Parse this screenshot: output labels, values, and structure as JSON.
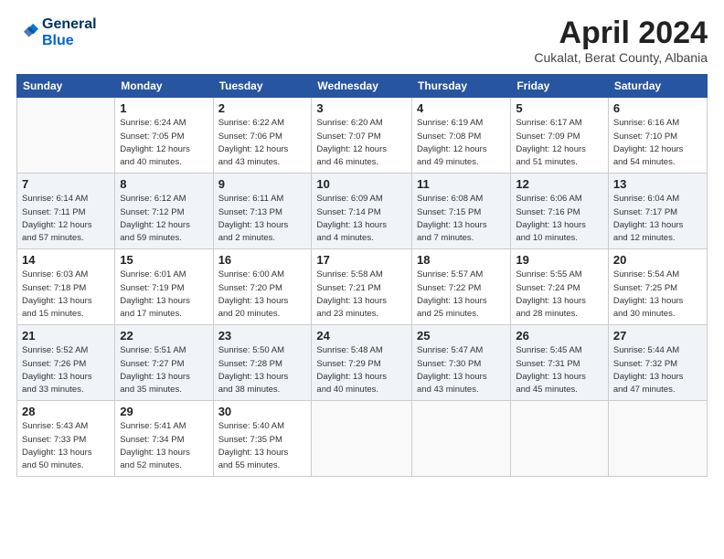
{
  "header": {
    "logo_line1": "General",
    "logo_line2": "Blue",
    "month": "April 2024",
    "location": "Cukalat, Berat County, Albania"
  },
  "days_of_week": [
    "Sunday",
    "Monday",
    "Tuesday",
    "Wednesday",
    "Thursday",
    "Friday",
    "Saturday"
  ],
  "weeks": [
    [
      {
        "day": "",
        "info": ""
      },
      {
        "day": "1",
        "info": "Sunrise: 6:24 AM\nSunset: 7:05 PM\nDaylight: 12 hours\nand 40 minutes."
      },
      {
        "day": "2",
        "info": "Sunrise: 6:22 AM\nSunset: 7:06 PM\nDaylight: 12 hours\nand 43 minutes."
      },
      {
        "day": "3",
        "info": "Sunrise: 6:20 AM\nSunset: 7:07 PM\nDaylight: 12 hours\nand 46 minutes."
      },
      {
        "day": "4",
        "info": "Sunrise: 6:19 AM\nSunset: 7:08 PM\nDaylight: 12 hours\nand 49 minutes."
      },
      {
        "day": "5",
        "info": "Sunrise: 6:17 AM\nSunset: 7:09 PM\nDaylight: 12 hours\nand 51 minutes."
      },
      {
        "day": "6",
        "info": "Sunrise: 6:16 AM\nSunset: 7:10 PM\nDaylight: 12 hours\nand 54 minutes."
      }
    ],
    [
      {
        "day": "7",
        "info": "Sunrise: 6:14 AM\nSunset: 7:11 PM\nDaylight: 12 hours\nand 57 minutes."
      },
      {
        "day": "8",
        "info": "Sunrise: 6:12 AM\nSunset: 7:12 PM\nDaylight: 12 hours\nand 59 minutes."
      },
      {
        "day": "9",
        "info": "Sunrise: 6:11 AM\nSunset: 7:13 PM\nDaylight: 13 hours\nand 2 minutes."
      },
      {
        "day": "10",
        "info": "Sunrise: 6:09 AM\nSunset: 7:14 PM\nDaylight: 13 hours\nand 4 minutes."
      },
      {
        "day": "11",
        "info": "Sunrise: 6:08 AM\nSunset: 7:15 PM\nDaylight: 13 hours\nand 7 minutes."
      },
      {
        "day": "12",
        "info": "Sunrise: 6:06 AM\nSunset: 7:16 PM\nDaylight: 13 hours\nand 10 minutes."
      },
      {
        "day": "13",
        "info": "Sunrise: 6:04 AM\nSunset: 7:17 PM\nDaylight: 13 hours\nand 12 minutes."
      }
    ],
    [
      {
        "day": "14",
        "info": "Sunrise: 6:03 AM\nSunset: 7:18 PM\nDaylight: 13 hours\nand 15 minutes."
      },
      {
        "day": "15",
        "info": "Sunrise: 6:01 AM\nSunset: 7:19 PM\nDaylight: 13 hours\nand 17 minutes."
      },
      {
        "day": "16",
        "info": "Sunrise: 6:00 AM\nSunset: 7:20 PM\nDaylight: 13 hours\nand 20 minutes."
      },
      {
        "day": "17",
        "info": "Sunrise: 5:58 AM\nSunset: 7:21 PM\nDaylight: 13 hours\nand 23 minutes."
      },
      {
        "day": "18",
        "info": "Sunrise: 5:57 AM\nSunset: 7:22 PM\nDaylight: 13 hours\nand 25 minutes."
      },
      {
        "day": "19",
        "info": "Sunrise: 5:55 AM\nSunset: 7:24 PM\nDaylight: 13 hours\nand 28 minutes."
      },
      {
        "day": "20",
        "info": "Sunrise: 5:54 AM\nSunset: 7:25 PM\nDaylight: 13 hours\nand 30 minutes."
      }
    ],
    [
      {
        "day": "21",
        "info": "Sunrise: 5:52 AM\nSunset: 7:26 PM\nDaylight: 13 hours\nand 33 minutes."
      },
      {
        "day": "22",
        "info": "Sunrise: 5:51 AM\nSunset: 7:27 PM\nDaylight: 13 hours\nand 35 minutes."
      },
      {
        "day": "23",
        "info": "Sunrise: 5:50 AM\nSunset: 7:28 PM\nDaylight: 13 hours\nand 38 minutes."
      },
      {
        "day": "24",
        "info": "Sunrise: 5:48 AM\nSunset: 7:29 PM\nDaylight: 13 hours\nand 40 minutes."
      },
      {
        "day": "25",
        "info": "Sunrise: 5:47 AM\nSunset: 7:30 PM\nDaylight: 13 hours\nand 43 minutes."
      },
      {
        "day": "26",
        "info": "Sunrise: 5:45 AM\nSunset: 7:31 PM\nDaylight: 13 hours\nand 45 minutes."
      },
      {
        "day": "27",
        "info": "Sunrise: 5:44 AM\nSunset: 7:32 PM\nDaylight: 13 hours\nand 47 minutes."
      }
    ],
    [
      {
        "day": "28",
        "info": "Sunrise: 5:43 AM\nSunset: 7:33 PM\nDaylight: 13 hours\nand 50 minutes."
      },
      {
        "day": "29",
        "info": "Sunrise: 5:41 AM\nSunset: 7:34 PM\nDaylight: 13 hours\nand 52 minutes."
      },
      {
        "day": "30",
        "info": "Sunrise: 5:40 AM\nSunset: 7:35 PM\nDaylight: 13 hours\nand 55 minutes."
      },
      {
        "day": "",
        "info": ""
      },
      {
        "day": "",
        "info": ""
      },
      {
        "day": "",
        "info": ""
      },
      {
        "day": "",
        "info": ""
      }
    ]
  ]
}
